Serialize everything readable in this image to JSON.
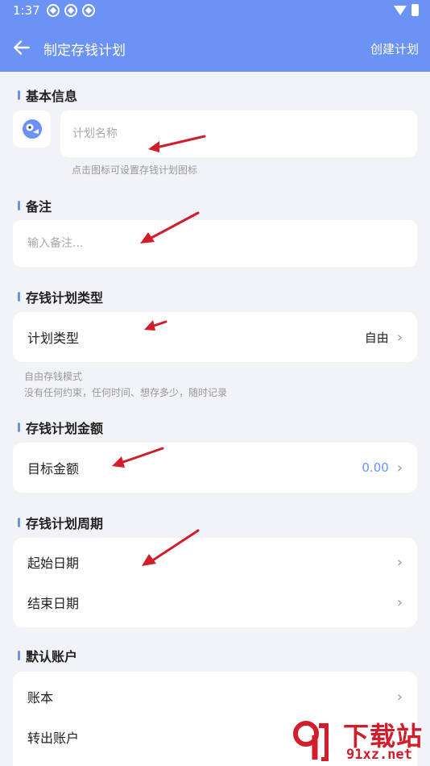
{
  "status": {
    "time": "1:37"
  },
  "appbar": {
    "title": "制定存钱计划",
    "action": "创建计划"
  },
  "basic": {
    "title": "基本信息",
    "name_placeholder": "计划名称",
    "icon_hint": "点击图标可设置存钱计划图标"
  },
  "note": {
    "title": "备注",
    "placeholder": "输入备注..."
  },
  "type": {
    "title": "存钱计划类型",
    "label": "计划类型",
    "value": "自由",
    "desc1": "自由存钱模式",
    "desc2": "没有任何约束，任何时间、想存多少，随时记录"
  },
  "amount": {
    "title": "存钱计划金额",
    "label": "目标金额",
    "value": "0.00"
  },
  "period": {
    "title": "存钱计划周期",
    "start_label": "起始日期",
    "end_label": "结束日期"
  },
  "account": {
    "title": "默认账户",
    "book_label": "账本",
    "out_label": "转出账户"
  },
  "watermark": {
    "cn": "下载站",
    "domain": "91xz.net"
  },
  "colors": {
    "accent": "#6b93f5",
    "annotation": "#d21d2a"
  }
}
